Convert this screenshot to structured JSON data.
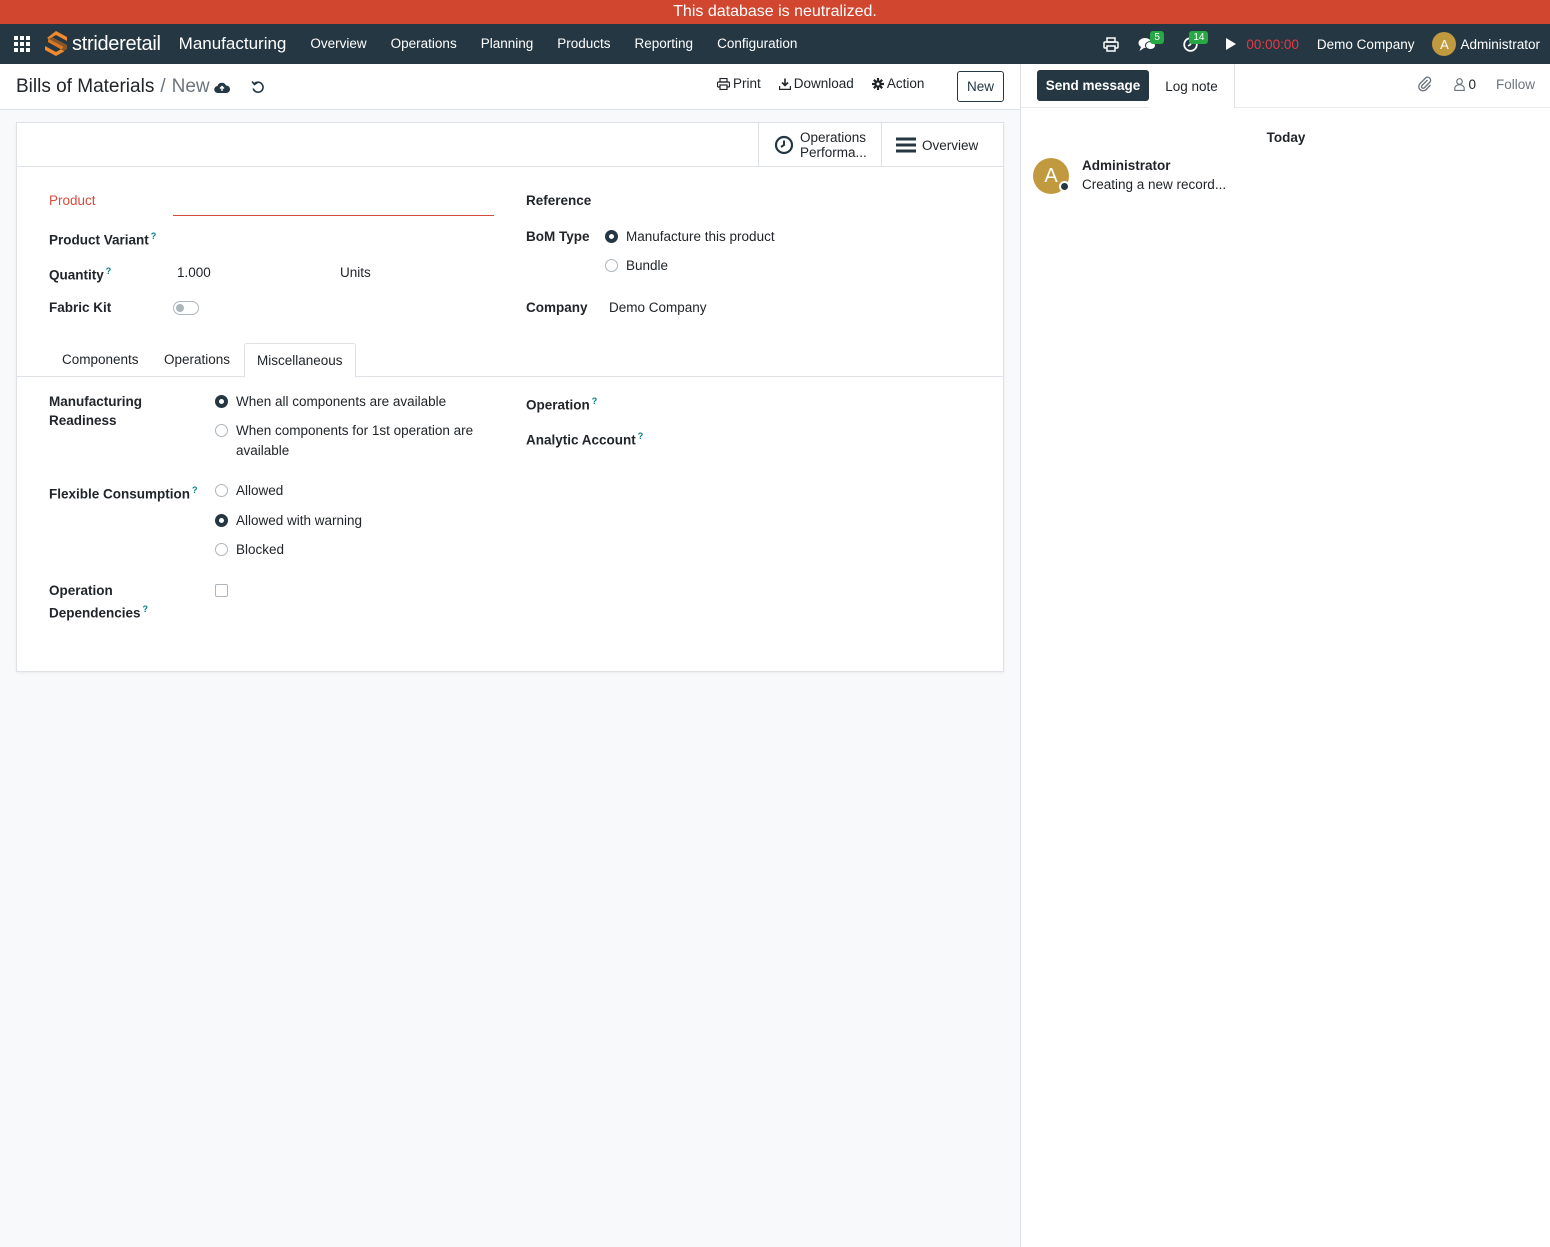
{
  "banner": {
    "text": "This database is neutralized."
  },
  "navbar": {
    "logo_text": "strideretail",
    "app_name": "Manufacturing",
    "menu": [
      "Overview",
      "Operations",
      "Planning",
      "Products",
      "Reporting",
      "Configuration"
    ],
    "messages_count": "5",
    "activities_count": "14",
    "timer": "00:00:00",
    "company": "Demo Company",
    "user_initial": "A",
    "user_name": "Administrator"
  },
  "control_panel": {
    "breadcrumb_parent": "Bills of Materials",
    "breadcrumb_separator": "/",
    "breadcrumb_current": "New",
    "print_label": "Print",
    "download_label": "Download",
    "action_label": "Action",
    "new_label": "New"
  },
  "smart_buttons": {
    "operations_line1": "Operations",
    "operations_line2": "Performa...",
    "overview_label": "Overview"
  },
  "form": {
    "product_label": "Product",
    "product_value": "",
    "product_variant_label": "Product Variant",
    "quantity_label": "Quantity",
    "quantity_value": "1.000",
    "quantity_uom": "Units",
    "fabric_kit_label": "Fabric Kit",
    "fabric_kit_on": false,
    "reference_label": "Reference",
    "bom_type_label": "BoM Type",
    "bom_type_options": [
      "Manufacture this product",
      "Bundle"
    ],
    "bom_type_selected": "Manufacture this product",
    "company_label": "Company",
    "company_value": "Demo Company",
    "help_mark": "?"
  },
  "tabs": [
    "Components",
    "Operations",
    "Miscellaneous"
  ],
  "active_tab": "Miscellaneous",
  "misc": {
    "readiness_label_1": "Manufacturing",
    "readiness_label_2": "Readiness",
    "readiness_option_1": "When all components are available",
    "readiness_option_2_line1": "When components for 1st operation are",
    "readiness_option_2_line2": "available",
    "readiness_selected": "When all components are available",
    "flexible_label": "Flexible Consumption",
    "flexible_options": [
      "Allowed",
      "Allowed with warning",
      "Blocked"
    ],
    "flexible_selected": "Allowed with warning",
    "op_dep_label_1": "Operation",
    "op_dep_label_2": "Dependencies",
    "op_dep_checked": false,
    "operation_label": "Operation",
    "analytic_label": "Analytic Account"
  },
  "chatter": {
    "send_message": "Send message",
    "log_note": "Log note",
    "followers_count": "0",
    "follow_label": "Follow",
    "date_separator": "Today",
    "messages": [
      {
        "avatar_initial": "A",
        "author": "Administrator",
        "body": "Creating a new record..."
      }
    ]
  },
  "colors": {
    "banner": "#d1462f",
    "navbar": "#243742",
    "primary": "#243742",
    "required": "#d44c3c",
    "badge": "#28a745",
    "timer": "#e63946",
    "avatar": "#c19a3f",
    "help": "#017e84"
  }
}
